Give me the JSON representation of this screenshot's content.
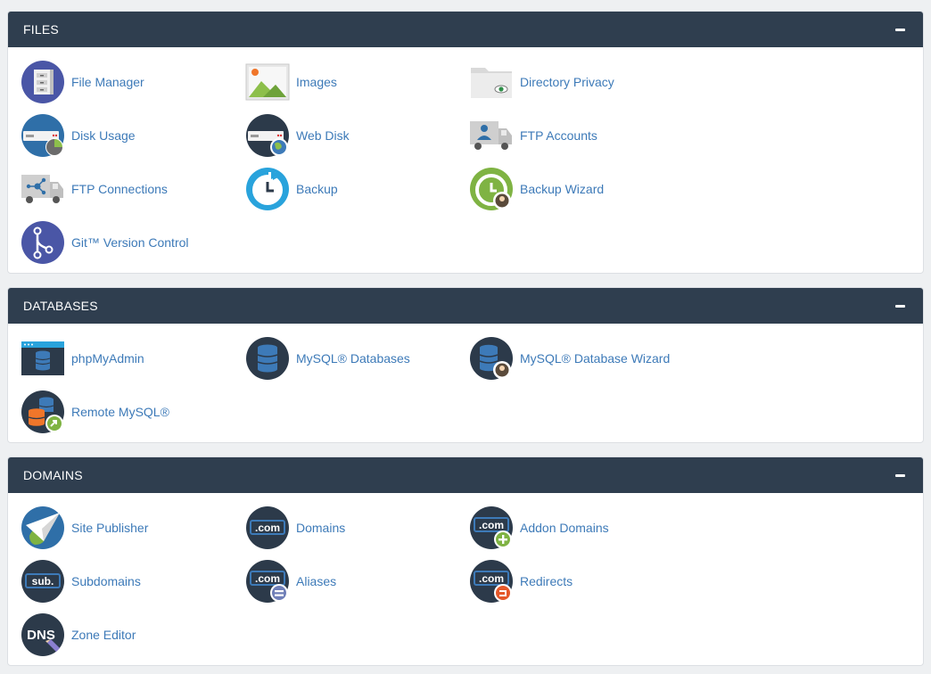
{
  "colors": {
    "header_bg": "#2f3e4f",
    "link": "#3d7ab8",
    "page_bg": "#eef0f2"
  },
  "files": {
    "title": "FILES",
    "items": [
      {
        "label": "File Manager",
        "icon": "file-cabinet-icon"
      },
      {
        "label": "Images",
        "icon": "image-icon"
      },
      {
        "label": "Directory Privacy",
        "icon": "folder-eye-icon"
      },
      {
        "label": "Disk Usage",
        "icon": "disk-pie-icon"
      },
      {
        "label": "Web Disk",
        "icon": "disk-globe-icon"
      },
      {
        "label": "FTP Accounts",
        "icon": "truck-user-icon"
      },
      {
        "label": "FTP Connections",
        "icon": "truck-network-icon"
      },
      {
        "label": "Backup",
        "icon": "clock-refresh-icon"
      },
      {
        "label": "Backup Wizard",
        "icon": "backup-wizard-icon"
      },
      {
        "label": "Git™ Version Control",
        "icon": "git-branch-icon"
      }
    ]
  },
  "databases": {
    "title": "DATABASES",
    "items": [
      {
        "label": "phpMyAdmin",
        "icon": "window-database-icon"
      },
      {
        "label": "MySQL® Databases",
        "icon": "database-icon"
      },
      {
        "label": "MySQL® Database Wizard",
        "icon": "database-wizard-icon"
      },
      {
        "label": "Remote MySQL®",
        "icon": "database-remote-icon"
      }
    ]
  },
  "domains": {
    "title": "DOMAINS",
    "items": [
      {
        "label": "Site Publisher",
        "icon": "paper-plane-globe-icon"
      },
      {
        "label": "Domains",
        "icon": "dotcom-icon",
        "badge_text": ".com"
      },
      {
        "label": "Addon Domains",
        "icon": "dotcom-add-icon",
        "badge_text": ".com"
      },
      {
        "label": "Subdomains",
        "icon": "subdomain-icon",
        "badge_text": "sub."
      },
      {
        "label": "Aliases",
        "icon": "dotcom-equal-icon",
        "badge_text": ".com"
      },
      {
        "label": "Redirects",
        "icon": "dotcom-redirect-icon",
        "badge_text": ".com"
      },
      {
        "label": "Zone Editor",
        "icon": "dns-pencil-icon",
        "badge_text": "DNS"
      }
    ]
  }
}
